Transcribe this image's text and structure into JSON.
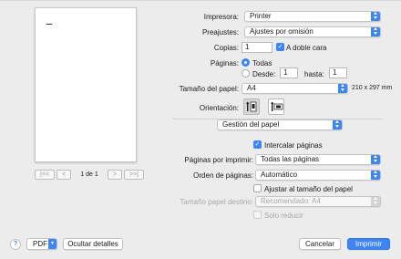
{
  "preview": {
    "page_label": "1 de 1",
    "first_icon": "|<<",
    "prev_icon": "<",
    "next_icon": ">",
    "last_icon": ">>|"
  },
  "printer": {
    "label": "Impresora:",
    "value": "Printer"
  },
  "presets": {
    "label": "Preajustes:",
    "value": "Ajustes por omisión"
  },
  "copies": {
    "label": "Copias:",
    "value": "1",
    "duplex_label": "A doble cara",
    "duplex_checked": true
  },
  "pages": {
    "label": "Páginas:",
    "all_label": "Todas",
    "from_label": "Desde:",
    "from_value": "1",
    "to_label": "hasta:",
    "to_value": "1"
  },
  "paper_size": {
    "label": "Tamaño del papel:",
    "value": "A4",
    "dimensions": "210 x 297 mm"
  },
  "orientation": {
    "label": "Orientación:"
  },
  "section": {
    "value": "Gestión del papel"
  },
  "collate": {
    "label": "Intercalar páginas",
    "checked": true
  },
  "pages_to_print": {
    "label": "Páginas por imprimir:",
    "value": "Todas las páginas"
  },
  "page_order": {
    "label": "Orden de páginas:",
    "value": "Automático"
  },
  "scale_to_fit": {
    "label": "Ajustar al tamaño del papel",
    "checked": false
  },
  "dest_paper": {
    "label": "Tamaño papel destino:",
    "value": "Recomendado: A4"
  },
  "scale_down": {
    "label": "Solo reducir",
    "checked": false
  },
  "bottom": {
    "help_icon": "?",
    "pdf_label": "PDF",
    "hide_details": "Ocultar detalles",
    "cancel": "Cancelar",
    "print": "Imprimir"
  },
  "colors": {
    "accent": "#3e85f4",
    "background": "#ececec"
  }
}
